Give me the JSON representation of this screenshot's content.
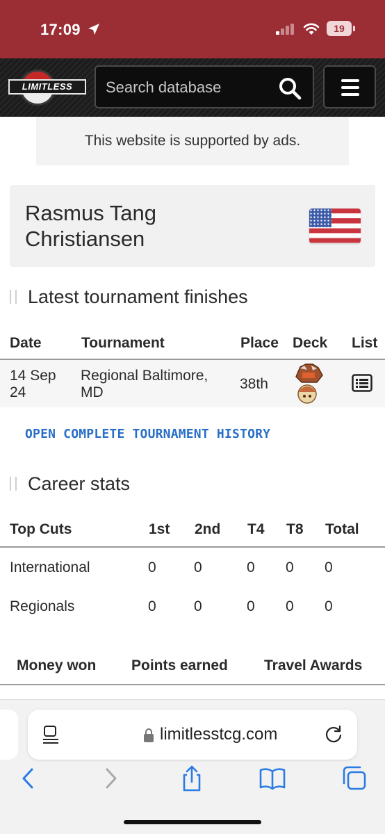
{
  "status_bar": {
    "time": "17:09",
    "battery": "19"
  },
  "header": {
    "logo_text": "LIMITLESS",
    "search_placeholder": "Search database"
  },
  "ad_notice": "This website is supported by ads.",
  "player": {
    "name": "Rasmus Tang Christiansen",
    "flag": "us-flag-icon"
  },
  "latest": {
    "title": "Latest tournament finishes",
    "columns": [
      "Date",
      "Tournament",
      "Place",
      "Deck",
      "List"
    ],
    "rows": [
      {
        "date": "14 Sep 24",
        "tournament": "Regional Baltimore, MD",
        "place": "38th",
        "deck": "deck-pokemon-icon",
        "list": "list-icon"
      }
    ]
  },
  "history_link": "OPEN COMPLETE TOURNAMENT HISTORY",
  "career": {
    "title": "Career stats",
    "columns": [
      "Top Cuts",
      "1st",
      "2nd",
      "T4",
      "T8",
      "Total"
    ],
    "rows": [
      {
        "label": "International",
        "values": [
          "0",
          "0",
          "0",
          "0",
          "0"
        ]
      },
      {
        "label": "Regionals",
        "values": [
          "0",
          "0",
          "0",
          "0",
          "0"
        ]
      }
    ]
  },
  "tabs": [
    "Money won",
    "Points earned",
    "Travel Awards"
  ],
  "browser": {
    "url": "limitlesstcg.com"
  },
  "colors": {
    "status_bar": "#9b2d34",
    "link": "#2a6fc7",
    "flag_red": "#c9353e",
    "flag_blue": "#3c5aa8"
  }
}
